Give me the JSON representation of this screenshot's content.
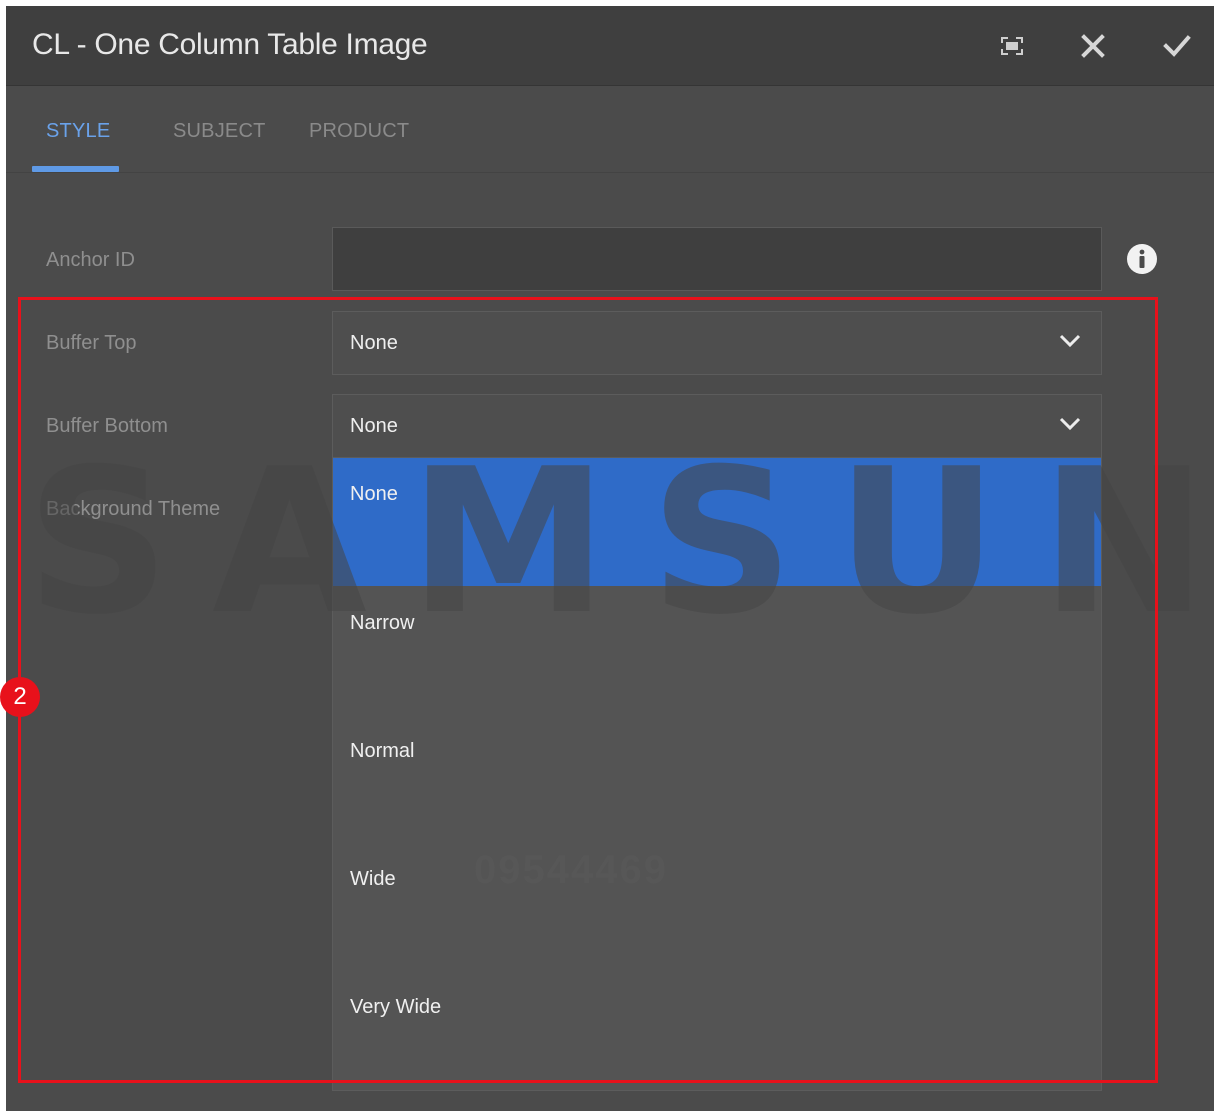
{
  "dialog": {
    "title": "CL - One Column Table Image",
    "icons": [
      "fullscreen-icon",
      "close-icon",
      "checkmark-icon"
    ]
  },
  "tabs": [
    {
      "label": "STYLE",
      "active": true
    },
    {
      "label": "SUBJECT",
      "active": false
    },
    {
      "label": "PRODUCT",
      "active": false
    }
  ],
  "form": {
    "anchor_id": {
      "label": "Anchor ID",
      "value": ""
    },
    "buffer_top": {
      "label": "Buffer Top",
      "value": "None"
    },
    "buffer_bottom": {
      "label": "Buffer Bottom",
      "value": "None"
    },
    "background_theme": {
      "label": "Background Theme"
    }
  },
  "dropdown": {
    "options": [
      "None",
      "Narrow",
      "Normal",
      "Wide",
      "Very Wide"
    ],
    "selected": "None"
  },
  "annotation": {
    "step_number": "2",
    "highlight_color": "#e8111b"
  },
  "watermark": {
    "brand": "SAMSUNG",
    "id": "09544469"
  },
  "colors": {
    "accent": "#5f9ae6",
    "selected_option": "#2f6bc8",
    "background": "#4b4b4b"
  }
}
